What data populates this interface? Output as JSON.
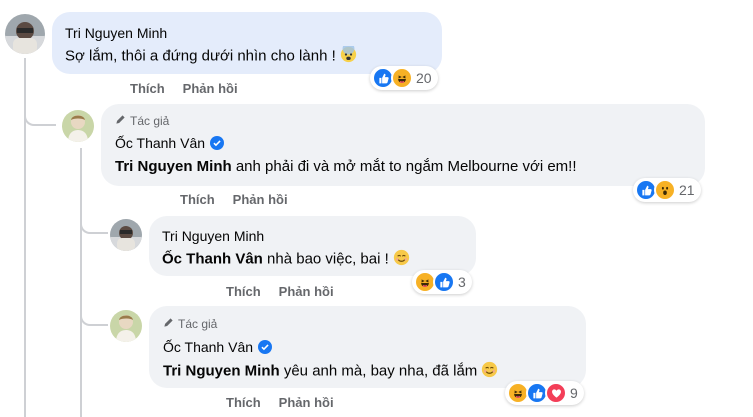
{
  "colors": {
    "bubble": "#f0f2f5",
    "bubble_highlight": "#e4ecfb",
    "like_blue": "#1877f2",
    "love_red": "#f33e58",
    "haha_yellow": "#f7b125",
    "muted_text": "#65676b"
  },
  "actions": {
    "like": "Thích",
    "reply": "Phản hồi"
  },
  "comments": [
    {
      "author": "Tri Nguyen Minh",
      "text": "Sợ lắm, thôi a đứng dưới nhìn cho lành !",
      "emoji": "fearful-face",
      "reactions": [
        "like-icon",
        "haha-icon"
      ],
      "reaction_count": "20"
    },
    {
      "author_tag": "Tác giả",
      "author": "Ốc Thanh Vân",
      "verified": true,
      "mention": "Tri Nguyen Minh",
      "text": "anh phải đi và mở mắt to ngắm Melbourne với em!!",
      "reactions": [
        "like-icon",
        "wow-icon"
      ],
      "reaction_count": "21"
    },
    {
      "author": "Tri Nguyen Minh",
      "mention": "Ốc Thanh Vân",
      "text": "nhà bao việc, bai !",
      "emoji": "smiling-face",
      "reactions": [
        "haha-icon",
        "like-icon"
      ],
      "reaction_count": "3"
    },
    {
      "author_tag": "Tác giả",
      "author": "Ốc Thanh Vân",
      "verified": true,
      "mention": "Tri Nguyen Minh",
      "text": "yêu anh mà, bay nha, đã lắm",
      "emoji": "smiling-face",
      "reactions": [
        "haha-icon",
        "like-icon",
        "love-icon"
      ],
      "reaction_count": "9"
    }
  ]
}
